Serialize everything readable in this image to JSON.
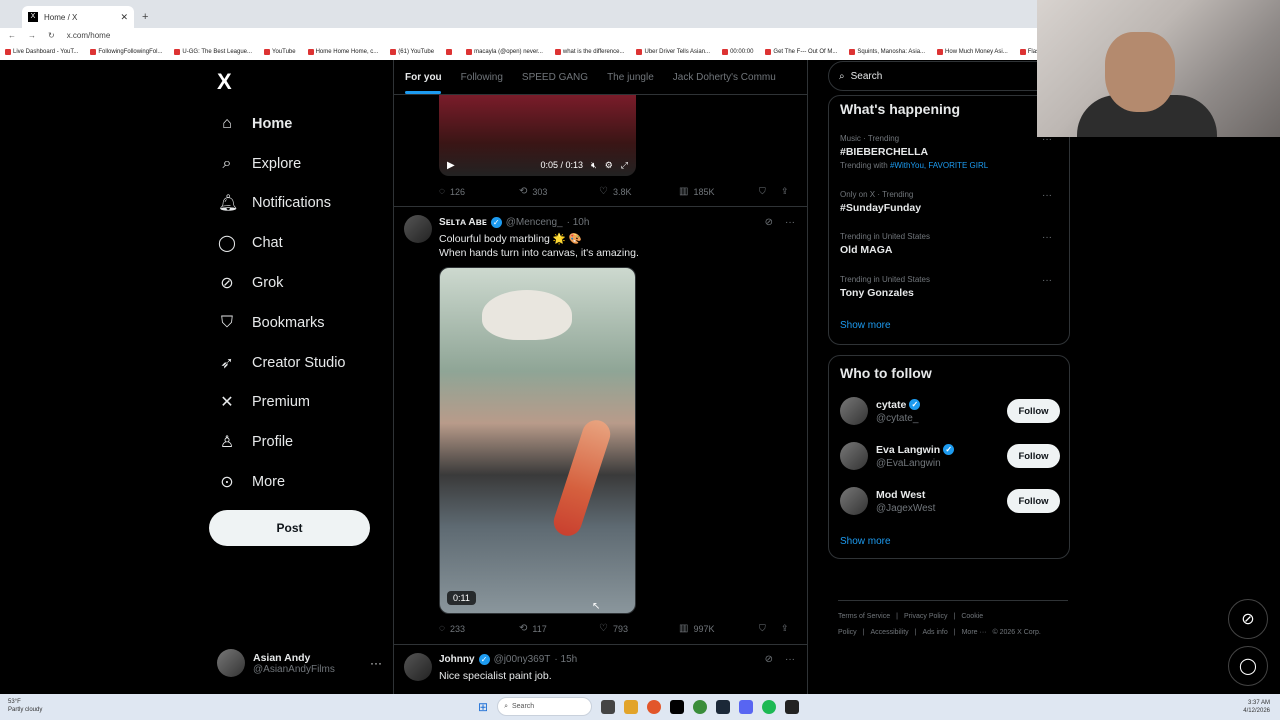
{
  "browser": {
    "tab_title": "Home / X",
    "url": "x.com/home",
    "bookmarks": [
      "Live Dashboard - YouT...",
      "FollowingFollowingFol...",
      "U-GG: The Best League...",
      "YouTube",
      "Home Home Home, c...",
      "(61) YouTube",
      "",
      "macayla (@open) never...",
      "what is the difference...",
      "Uber Driver Tells Asian...",
      "00:00:00",
      "Get The F--- Out Of M...",
      "Squints, Manosha: Asia...",
      "How Much Money Asi...",
      "FlashTorch Mini - The..."
    ]
  },
  "sidebar": {
    "logo": "X",
    "items": [
      {
        "label": "Home",
        "icon": "home-icon",
        "glyph": "⌂"
      },
      {
        "label": "Explore",
        "icon": "search-icon",
        "glyph": "⌕"
      },
      {
        "label": "Notifications",
        "icon": "bell-icon",
        "glyph": "🔔︎"
      },
      {
        "label": "Chat",
        "icon": "chat-icon",
        "glyph": "◯"
      },
      {
        "label": "Grok",
        "icon": "grok-icon",
        "glyph": "⊘"
      },
      {
        "label": "Bookmarks",
        "icon": "bookmark-icon",
        "glyph": "⛉"
      },
      {
        "label": "Creator Studio",
        "icon": "rocket-icon",
        "glyph": "➶"
      },
      {
        "label": "Premium",
        "icon": "x-icon",
        "glyph": "✕"
      },
      {
        "label": "Profile",
        "icon": "person-icon",
        "glyph": "♙"
      },
      {
        "label": "More",
        "icon": "more-circle-icon",
        "glyph": "⊙"
      }
    ],
    "post_label": "Post",
    "account": {
      "name": "Asian Andy",
      "handle": "@AsianAndyFilms"
    }
  },
  "feed": {
    "tabs": [
      "For you",
      "Following",
      "SPEED GANG",
      "The jungle",
      "Jack Doherty's Commu"
    ],
    "video1": {
      "time": "0:05 / 0:13"
    },
    "post1_stats": {
      "replies": "126",
      "reposts": "303",
      "likes": "3.8K",
      "views": "185K"
    },
    "post2": {
      "name": "Sᴇʟᴛᴀ Aʙᴇ",
      "handle": "@Menceng_",
      "time": "· 10h",
      "line1": "Colourful body marbling 🌟 🎨",
      "line2": "When hands turn into canvas, it's amazing.",
      "duration": "0:11",
      "stats": {
        "replies": "233",
        "reposts": "117",
        "likes": "793",
        "views": "997K"
      }
    },
    "post3": {
      "name": "Johnny",
      "handle": "@j00ny369T",
      "time": "· 15h",
      "text": "Nice specialist paint job."
    }
  },
  "right": {
    "search_placeholder": "Search",
    "happening_title": "What's happening",
    "trends": [
      {
        "meta": "Music · Trending",
        "name": "#BIEBERCHELLA",
        "with_label": "Trending with",
        "with_tags": "#WithYou, FAVORITE GIRL"
      },
      {
        "meta": "Only on X · Trending",
        "name": "#SundayFunday"
      },
      {
        "meta": "Trending in United States",
        "name": "Old MAGA"
      },
      {
        "meta": "Trending in United States",
        "name": "Tony Gonzales"
      }
    ],
    "show_more": "Show more",
    "follow_title": "Who to follow",
    "follow": [
      {
        "name": "cytate",
        "handle": "@cytate_"
      },
      {
        "name": "Eva Langwin",
        "handle": "@EvaLangwin"
      },
      {
        "name": "Mod West",
        "handle": "@JagexWest"
      }
    ],
    "follow_label": "Follow",
    "footer": [
      "Terms of Service",
      "|",
      "Privacy Policy",
      "|",
      "Cookie Policy",
      "|",
      "Accessibility",
      "|",
      "Ads info",
      "|",
      "More ···",
      "© 2026 X Corp."
    ]
  },
  "taskbar": {
    "weather_temp": "53°F",
    "weather_desc": "Partly cloudy",
    "search": "Search",
    "time": "3:37 AM",
    "date": "4/12/2026"
  },
  "colors": {
    "accent": "#1d9bf0",
    "background": "#000000",
    "muted": "#71767b"
  }
}
